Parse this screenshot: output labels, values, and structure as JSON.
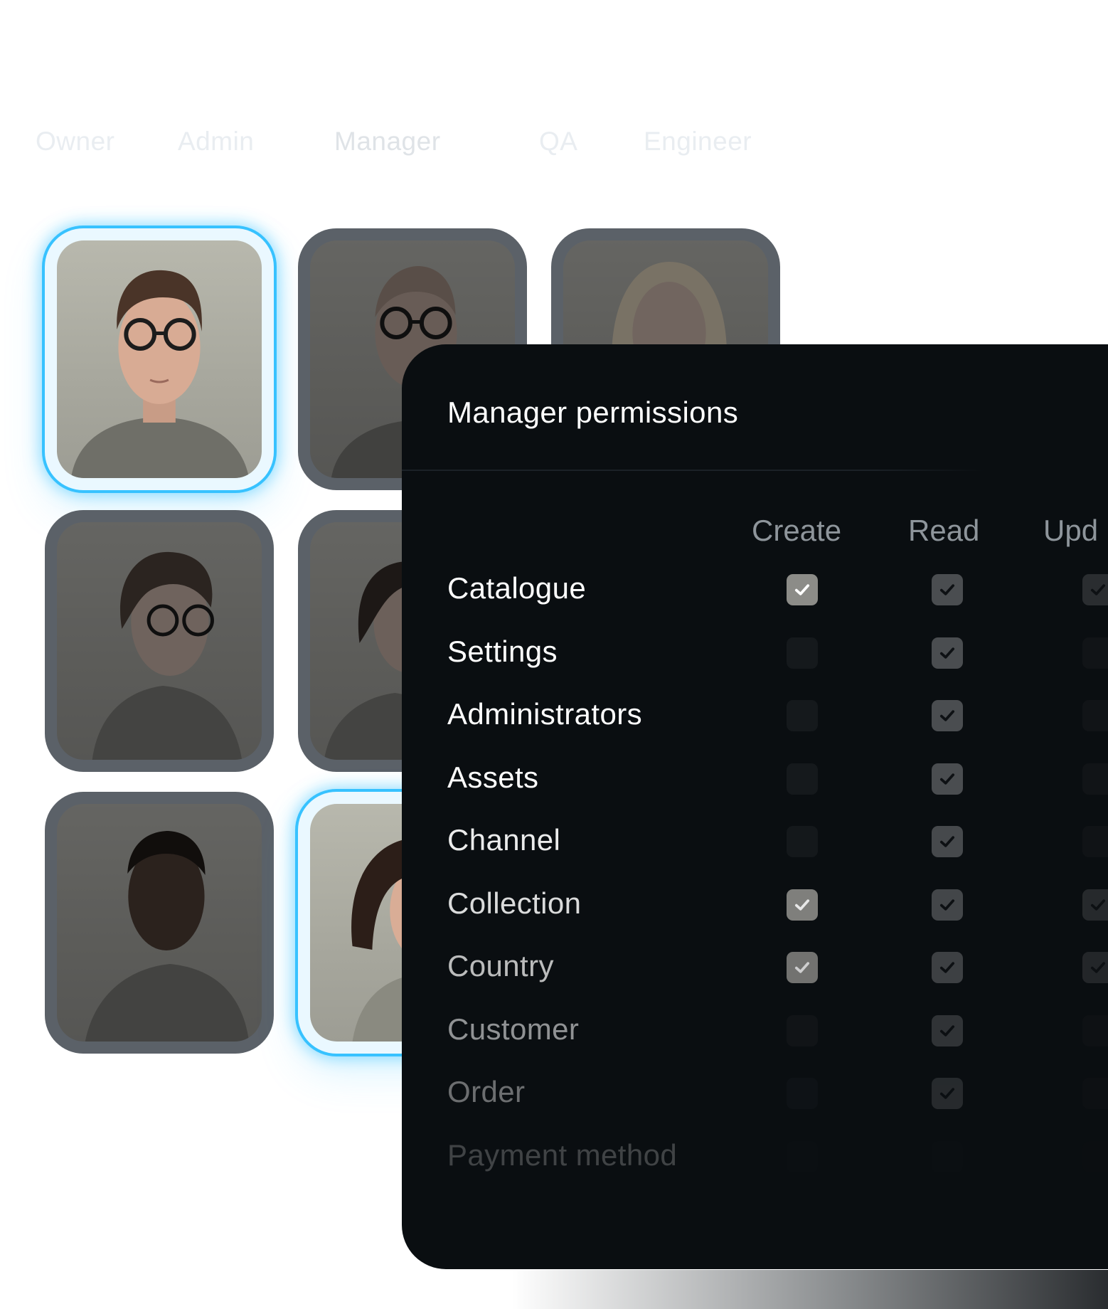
{
  "roles": [
    "Owner",
    "Admin",
    "Manager",
    "QA",
    "Engineer"
  ],
  "avatars": [
    {
      "name": "avatar-young-man-glasses",
      "selected": true
    },
    {
      "name": "avatar-bald-man-glasses",
      "selected": false
    },
    {
      "name": "avatar-blonde-woman",
      "selected": false
    },
    {
      "name": "avatar-short-hair-woman-glasses",
      "selected": false
    },
    {
      "name": "avatar-woman-ponytail",
      "selected": false
    },
    {
      "name": "avatar-empty",
      "selected": false
    },
    {
      "name": "avatar-man-dark-skin",
      "selected": false
    },
    {
      "name": "avatar-woman-bob",
      "selected": true
    }
  ],
  "panel": {
    "title": "Manager permissions",
    "columns": [
      "Create",
      "Read",
      "Upd"
    ],
    "rows": [
      {
        "label": "Catalogue",
        "create": true,
        "read": true,
        "update": true
      },
      {
        "label": "Settings",
        "create": false,
        "read": true,
        "update": false
      },
      {
        "label": "Administrators",
        "create": false,
        "read": true,
        "update": false
      },
      {
        "label": "Assets",
        "create": false,
        "read": true,
        "update": false
      },
      {
        "label": "Channel",
        "create": false,
        "read": true,
        "update": false
      },
      {
        "label": "Collection",
        "create": true,
        "read": true,
        "update": true
      },
      {
        "label": "Country",
        "create": true,
        "read": true,
        "update": true
      },
      {
        "label": "Customer",
        "create": false,
        "read": true,
        "update": false
      },
      {
        "label": "Order",
        "create": false,
        "read": true,
        "update": false
      },
      {
        "label": "Payment method",
        "create": false,
        "read": false,
        "update": false
      }
    ]
  },
  "colors": {
    "accent": "#37c2ff",
    "panel_bg": "#0a0e11",
    "checkbox_checked": "#8c8c88",
    "checkbox_read": "#4a4d50"
  }
}
